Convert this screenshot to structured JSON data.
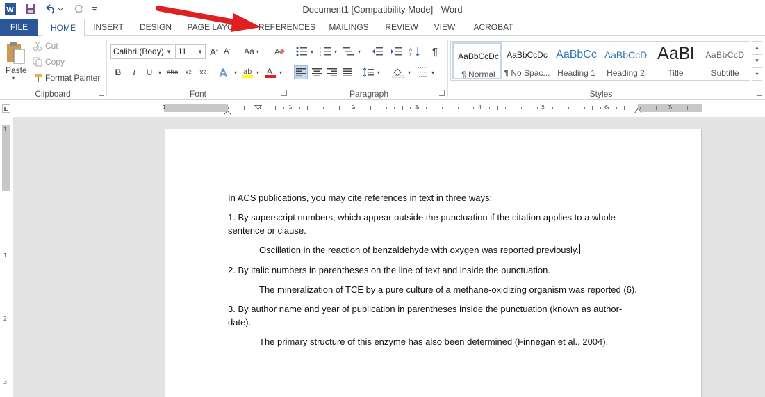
{
  "window": {
    "title": "Document1 [Compatibility Mode] - Word"
  },
  "tabs": [
    {
      "label": "FILE"
    },
    {
      "label": "HOME"
    },
    {
      "label": "INSERT"
    },
    {
      "label": "DESIGN"
    },
    {
      "label": "PAGE LAYOUT"
    },
    {
      "label": "REFERENCES"
    },
    {
      "label": "MAILINGS"
    },
    {
      "label": "REVIEW"
    },
    {
      "label": "VIEW"
    },
    {
      "label": "ACROBAT"
    }
  ],
  "clipboard": {
    "group_label": "Clipboard",
    "paste_label": "Paste",
    "cut_label": "Cut",
    "copy_label": "Copy",
    "format_painter_label": "Format Painter"
  },
  "font": {
    "group_label": "Font",
    "font_name": "Calibri (Body)",
    "font_size": "11",
    "change_case": "Aa"
  },
  "paragraph": {
    "group_label": "Paragraph"
  },
  "styles": {
    "group_label": "Styles",
    "items": [
      {
        "sample": "AaBbCcDc",
        "name": "¶ Normal"
      },
      {
        "sample": "AaBbCcDc",
        "name": "¶ No Spac..."
      },
      {
        "sample": "AaBbCc",
        "name": "Heading 1"
      },
      {
        "sample": "AaBbCcD",
        "name": "Heading 2"
      },
      {
        "sample": "AaBl",
        "name": "Title"
      },
      {
        "sample": "AaBbCcD",
        "name": "Subtitle"
      }
    ]
  },
  "ruler": {
    "h_numbers": [
      "1",
      "1",
      "2",
      "3",
      "4",
      "5",
      "6",
      "7"
    ],
    "v_numbers": [
      "1",
      "1",
      "2",
      "3"
    ]
  },
  "document": {
    "paragraphs": [
      "In ACS publications, you may cite references in text in three ways:",
      "1. By superscript numbers, which appear outside the punctuation if the citation applies to a whole",
      "sentence or clause.",
      "Oscillation in the reaction of benzaldehyde with oxygen was reported previously.",
      "2. By italic numbers in parentheses on the line of text and inside the punctuation.",
      "The mineralization of TCE by a pure culture of a methane-oxidizing organism was reported (6).",
      "3. By author name and year of publication in parentheses inside the punctuation (known as author-",
      "date).",
      "The primary structure of this enzyme has also been determined (Finnegan et al., 2004)."
    ]
  },
  "colors": {
    "accent": "#2b579a",
    "annotation_arrow": "#e02020"
  }
}
